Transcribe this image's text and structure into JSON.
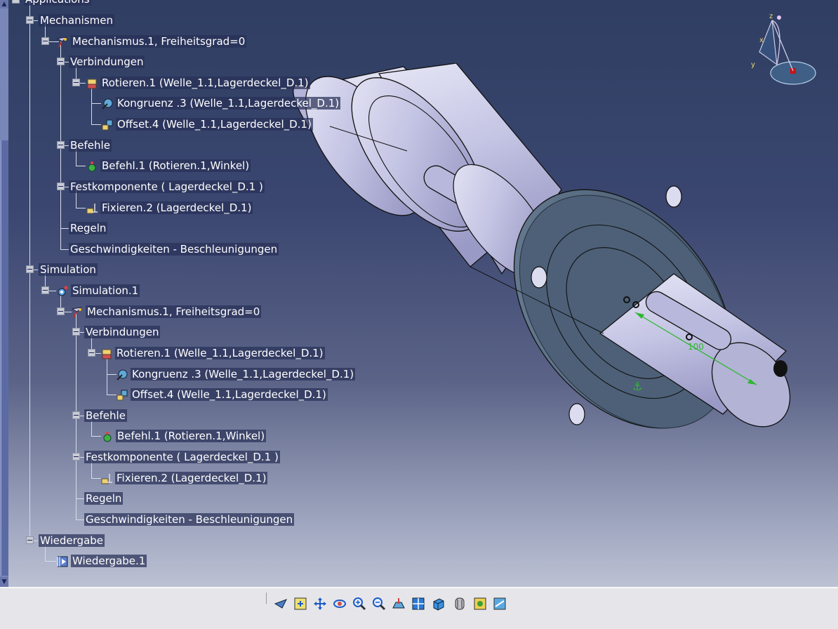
{
  "tree": {
    "root_label": "Applications",
    "mechanisms_label": "Mechanismen",
    "mechanism1": "Mechanismus.1, Freiheitsgrad=0",
    "verbindungen_label": "Verbindungen",
    "rotieren1": "Rotieren.1 (Welle_1.1,Lagerdeckel_D.1)",
    "kongruenz3": "Kongruenz .3 (Welle_1.1,Lagerdeckel_D.1)",
    "offset4": "Offset.4 (Welle_1.1,Lagerdeckel_D.1)",
    "befehle_label": "Befehle",
    "befehl1": "Befehl.1 (Rotieren.1,Winkel)",
    "festkomponente": "Festkomponente ( Lagerdeckel_D.1 )",
    "fixieren2": "Fixieren.2 (Lagerdeckel_D.1)",
    "regeln_label": "Regeln",
    "geschwindigkeiten_label": "Geschwindigkeiten - Beschleunigungen",
    "simulation_label": "Simulation",
    "simulation1": "Simulation.1",
    "wiedergabe_label": "Wiedergabe",
    "wiedergabe1": "Wiedergabe.1"
  },
  "viewport": {
    "dimension_label": "100",
    "compass_axes": [
      "z",
      "x",
      "y"
    ]
  },
  "toolbar": {
    "buttons": [
      "fly-mode-icon",
      "fit-all-icon",
      "pan-icon",
      "rotate-icon",
      "zoom-in-icon",
      "zoom-out-icon",
      "normal-view-icon",
      "multi-view-icon",
      "iso-view-icon",
      "render-style-icon",
      "hide-show-icon",
      "swap-visible-icon"
    ]
  },
  "colors": {
    "background_top": "#2f3e62",
    "background_bottom": "#bcc1d3",
    "part_face": "#c8c8e8",
    "flange_face": "#4f6278",
    "dimension_green": "#2db82d"
  }
}
